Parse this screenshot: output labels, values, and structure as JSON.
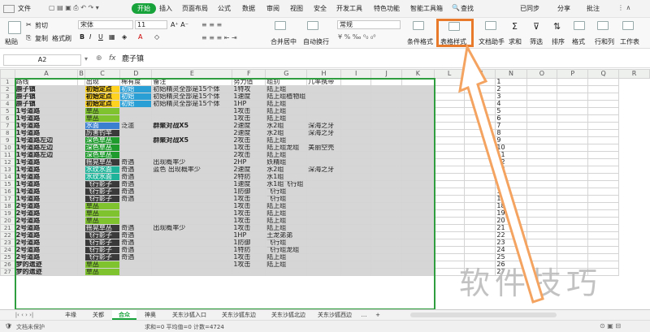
{
  "menu": [
    "文件",
    "开始",
    "插入",
    "页面布局",
    "公式",
    "数据",
    "审阅",
    "视图",
    "安全",
    "开发工具",
    "特色功能",
    "智能工具箱",
    "查找"
  ],
  "menu_right": {
    "cloud": "已同步",
    "share": "分享",
    "annotate": "批注"
  },
  "ribbon": {
    "paste": "粘贴",
    "cut": "剪切",
    "copy": "复制",
    "format_painter": "格式刷",
    "font": "宋体",
    "size": "11",
    "num_format": "常规",
    "merge": "合并居中",
    "wrap": "自动换行",
    "cond_format": "条件格式",
    "table_style": "表格样式",
    "doc_helper": "文档助手",
    "sum": "求和",
    "filter": "筛选",
    "sort": "排序",
    "format": "格式",
    "rowcol": "行和列",
    "worksheet": "工作表"
  },
  "formula": {
    "cell_ref": "A2",
    "fx": "fx",
    "value": "鹿子镇"
  },
  "columns": [
    "",
    "A",
    "B",
    "C",
    "D",
    "E",
    "F",
    "G",
    "H",
    "I",
    "J",
    "K",
    "L",
    "M",
    "N",
    "O",
    "P",
    "Q",
    "R"
  ],
  "rows": [
    {
      "n": "1",
      "a": "路线",
      "c": "出现",
      "d": "稀有度",
      "e": "备注",
      "f": "努力值",
      "g": "组别",
      "h": "几率携带"
    },
    {
      "n": "2",
      "a": "鹿子镇",
      "c": "初始定点",
      "cs": "yellow",
      "d": "初始",
      "ds": "cyan",
      "e": "初始精灵全部是15个体",
      "f": "1特攻",
      "g": "陆上组"
    },
    {
      "n": "3",
      "a": "鹿子镇",
      "c": "初始定点",
      "cs": "yellow",
      "d": "初始",
      "ds": "cyan",
      "e": "初始精灵全部是15个体",
      "f": "1速度",
      "g": "陆上组植物组"
    },
    {
      "n": "4",
      "a": "鹿子镇",
      "c": "初始定点",
      "cs": "yellow",
      "d": "初始",
      "ds": "cyan",
      "e": "初始精灵全部是15个体",
      "f": "1HP",
      "g": "陆上组"
    },
    {
      "n": "5",
      "a": "1号道路",
      "c": "草丛",
      "cs": "green",
      "f": "1攻击",
      "g": "陆上组"
    },
    {
      "n": "6",
      "a": "1号道路",
      "c": "草丛",
      "cs": "green",
      "f": "1攻击",
      "g": "陆上组"
    },
    {
      "n": "7",
      "a": "1号道路",
      "c": "水面",
      "cs": "blue",
      "d": "泛滥",
      "e": "群聚对战X5",
      "f": "2速度",
      "g": "水2组",
      "h": "深海之牙"
    },
    {
      "n": "8",
      "a": "1号道路",
      "c": "厉害钓竿",
      "cs": "dark",
      "e": "",
      "f": "2速度",
      "g": "水2组",
      "h": "深海之牙"
    },
    {
      "n": "9",
      "a": "1号道路左边",
      "c": "深色草丛",
      "cs": "dkgreen",
      "e": "群聚对战X5",
      "f": "2攻击",
      "g": "陆上组"
    },
    {
      "n": "10",
      "a": "1号道路左边",
      "c": "深色草丛",
      "cs": "dkgreen",
      "f": "1攻击",
      "g": "陆上组龙组",
      "h": "美丽空壳"
    },
    {
      "n": "11",
      "a": "1号道路左边",
      "c": "深色草丛",
      "cs": "dkgreen",
      "f": "2攻击",
      "g": "陆上组"
    },
    {
      "n": "12",
      "a": "1号道路",
      "c": "摇晃草丛",
      "cs": "dark",
      "d": "奇遇",
      "e": "出现概率少",
      "f": "2HP",
      "g": "妖精组"
    },
    {
      "n": "13",
      "a": "1号道路",
      "c": "水纹水面",
      "cs": "teal",
      "d": "奇遇",
      "e": "蓝色 出现概率少",
      "f": "2速度",
      "g": "水2组",
      "h": "深海之牙"
    },
    {
      "n": "14",
      "a": "1号道路",
      "c": "水纹水面",
      "cs": "teal",
      "d": "奇遇",
      "f": "2特防",
      "g": "水1组"
    },
    {
      "n": "15",
      "a": "1号道路",
      "c": "飞行影子",
      "cs": "dark",
      "d": "奇遇",
      "f": "1速度",
      "g": "水1组飞行组"
    },
    {
      "n": "16",
      "a": "1号道路",
      "c": "飞行影子",
      "cs": "dark",
      "d": "奇遇",
      "f": "1防御",
      "g": "飞行组"
    },
    {
      "n": "17",
      "a": "1号道路",
      "c": "飞行影子",
      "cs": "dark",
      "d": "奇遇",
      "f": "1攻击",
      "g": "飞行组"
    },
    {
      "n": "18",
      "a": "2号道路",
      "c": "草丛",
      "cs": "green",
      "f": "1攻击",
      "g": "陆上组"
    },
    {
      "n": "19",
      "a": "2号道路",
      "c": "草丛",
      "cs": "green",
      "f": "1攻击",
      "g": "陆上组"
    },
    {
      "n": "20",
      "a": "2号道路",
      "c": "草丛",
      "cs": "green",
      "f": "1攻击",
      "g": "陆上组"
    },
    {
      "n": "21",
      "a": "2号道路",
      "c": "摇晃草丛",
      "cs": "dark",
      "d": "奇遇",
      "e": "出现概率少",
      "f": "1攻击",
      "g": "陆上组"
    },
    {
      "n": "22",
      "a": "2号道路",
      "c": "飞行影子",
      "cs": "dark",
      "d": "奇遇",
      "f": "1HP",
      "g": "土龙弟弟"
    },
    {
      "n": "23",
      "a": "2号道路",
      "c": "飞行影子",
      "cs": "dark",
      "d": "奇遇",
      "f": "1防御",
      "g": "飞行组"
    },
    {
      "n": "24",
      "a": "2号道路",
      "c": "飞行影子",
      "cs": "dark",
      "d": "奇遇",
      "f": "1特防",
      "g": "飞行组龙组"
    },
    {
      "n": "25",
      "a": "2号道路",
      "c": "飞行影子",
      "cs": "dark",
      "d": "奇遇",
      "f": "1攻击",
      "g": "陆上组"
    },
    {
      "n": "26",
      "a": "梦的遗迹",
      "c": "草丛",
      "cs": "green",
      "f": "1攻击",
      "g": "陆上组"
    },
    {
      "n": "27",
      "a": "梦的遗迹",
      "c": "草丛",
      "cs": "green"
    }
  ],
  "tabs": [
    "丰缘",
    "关都",
    "合众",
    "神奥",
    "关东沙狐入口",
    "关东沙狐东边",
    "关东沙狐北边",
    "关东沙狐西边"
  ],
  "active_tab": "合众",
  "status": {
    "protect": "文档未保护",
    "stats": "求和=0  平均值=0  计数=4724"
  },
  "watermark": "软件技巧"
}
